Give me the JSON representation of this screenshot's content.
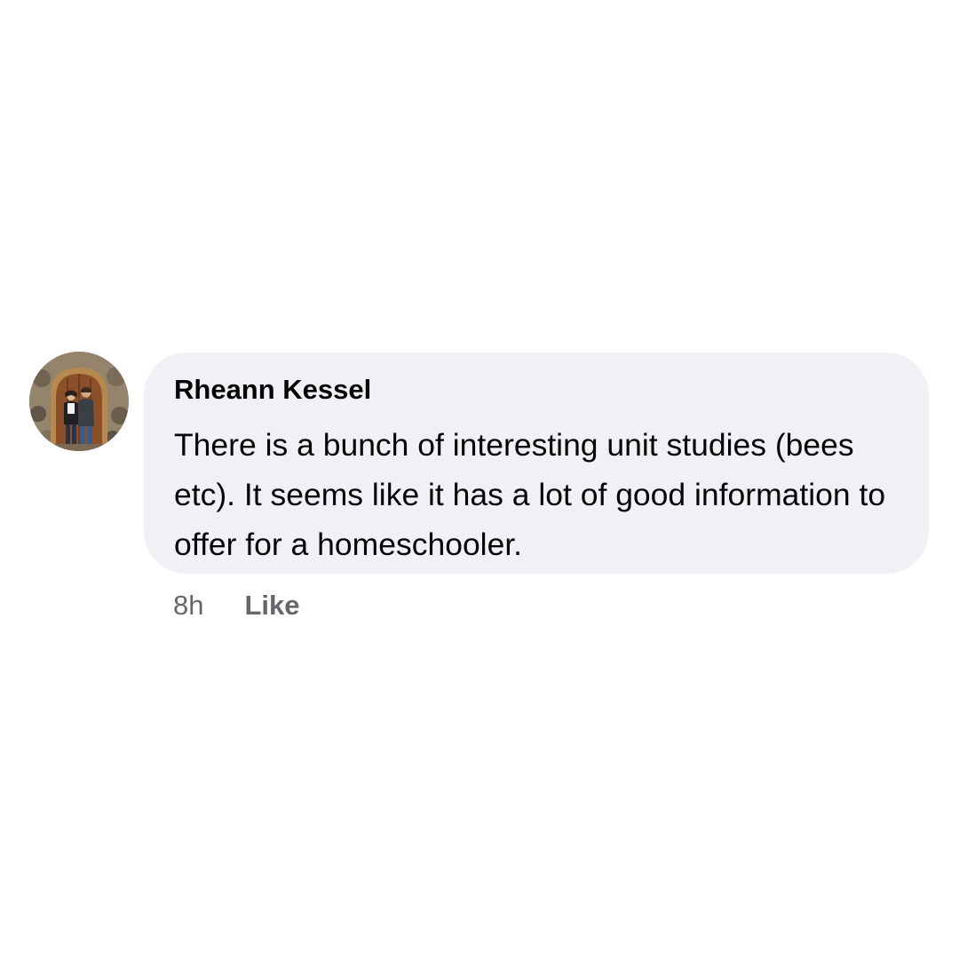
{
  "comment": {
    "author": "Rheann Kessel",
    "avatar_icon": "profile-photo",
    "text": "There is a bunch of interesting unit studies (bees etc). It seems like it has a lot of good information to offer for a homeschooler.",
    "bubble_color": "#f0f1f5"
  },
  "actions": {
    "timestamp": "8h",
    "like_label": "Like",
    "muted_color": "#65676b"
  }
}
